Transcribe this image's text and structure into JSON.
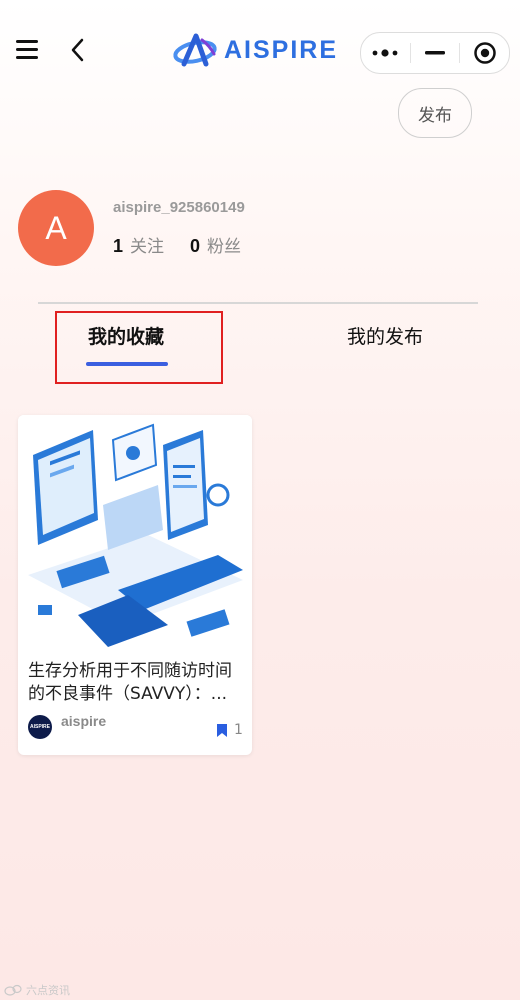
{
  "header": {
    "logo_text": "AISPIRE",
    "publish_label": "发布"
  },
  "profile": {
    "avatar_letter": "A",
    "username": "aispire_925860149",
    "following_count": "1",
    "following_label": "关注",
    "followers_count": "0",
    "followers_label": "粉丝"
  },
  "tabs": {
    "favorites": "我的收藏",
    "published": "我的发布"
  },
  "card": {
    "title_line1": "生存分析用于不同随访时间",
    "title_line2": "的不良事件（SAVVY）：...",
    "author_name": "aispire",
    "author_avatar_text": "AISPIRE",
    "bookmark_count": "1"
  },
  "watermark": "六点资讯",
  "colors": {
    "accent": "#3b5fe0",
    "avatar": "#f26b4b",
    "highlight": "#e02020"
  }
}
